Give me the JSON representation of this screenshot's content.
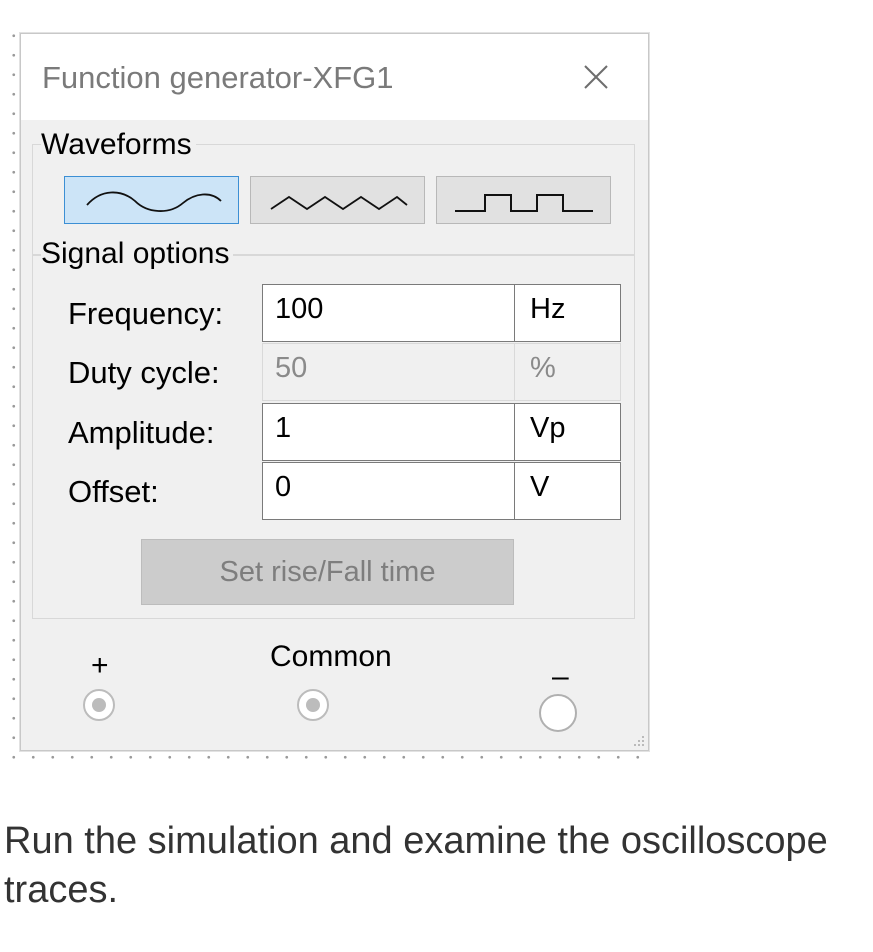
{
  "window": {
    "title": "Function generator-XFG1",
    "close_icon": "close-icon"
  },
  "waveforms": {
    "label": "Waveforms",
    "buttons": [
      {
        "icon": "sine-wave-icon",
        "selected": true
      },
      {
        "icon": "triangle-wave-icon",
        "selected": false
      },
      {
        "icon": "square-wave-icon",
        "selected": false
      }
    ]
  },
  "signal_options": {
    "label": "Signal options",
    "rows": [
      {
        "label": "Frequency:",
        "value": "100",
        "unit": "Hz",
        "enabled": true
      },
      {
        "label": "Duty cycle:",
        "value": "50",
        "unit": "%",
        "enabled": false
      },
      {
        "label": "Amplitude:",
        "value": "1",
        "unit": "Vp",
        "enabled": true
      },
      {
        "label": "Offset:",
        "value": "0",
        "unit": "V",
        "enabled": true
      }
    ],
    "rise_fall_button": "Set rise/Fall time"
  },
  "terminals": {
    "plus": "+",
    "common": "Common",
    "minus": "–"
  },
  "caption": {
    "line1": "Run the simulation and examine the oscilloscope",
    "line2": "traces."
  },
  "colors": {
    "selected_bg": "#cce4f7",
    "selected_border": "#3c8fd4",
    "dialog_bg": "#f0f0f0"
  }
}
